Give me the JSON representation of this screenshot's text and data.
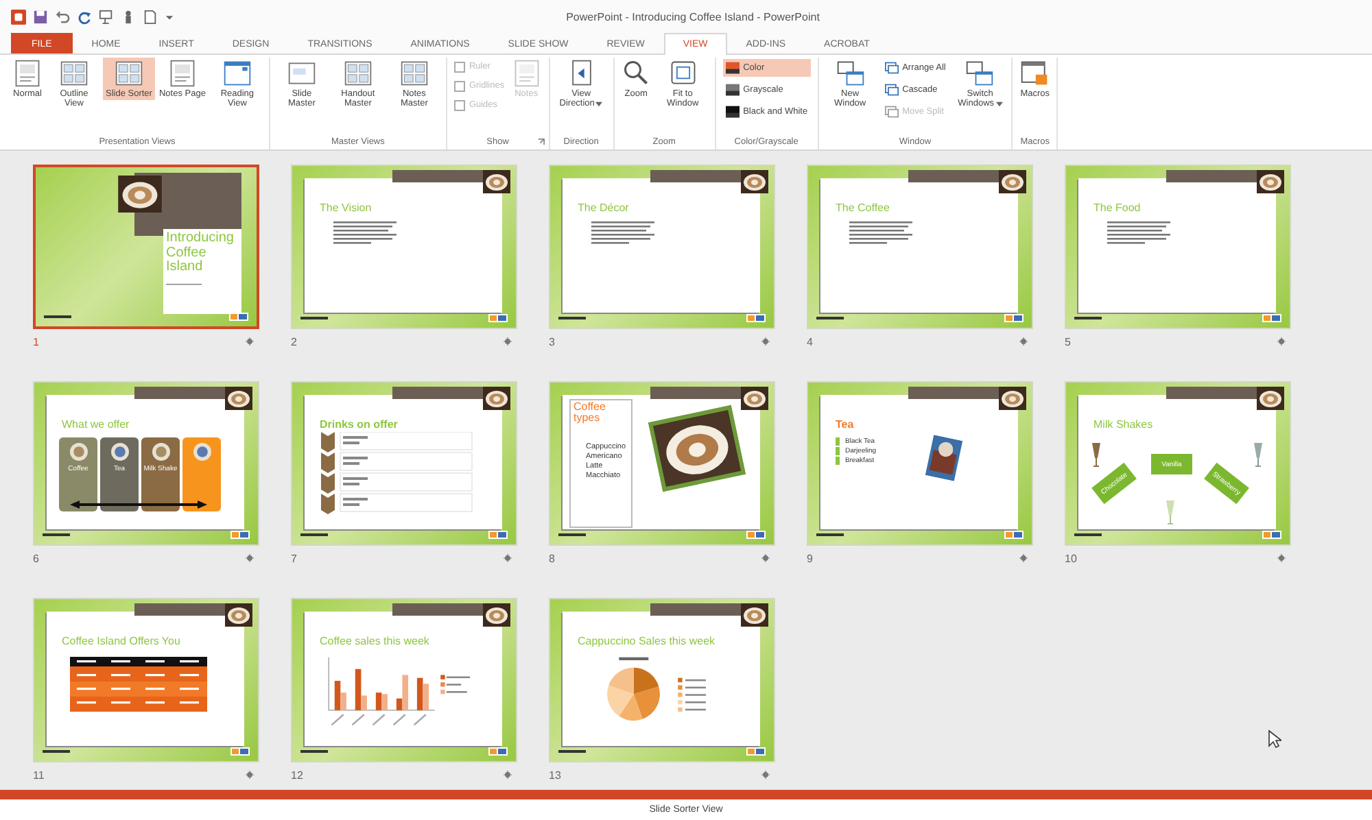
{
  "window": {
    "title": "PowerPoint - Introducing Coffee Island - PowerPoint"
  },
  "ribbon_tabs": [
    {
      "label": "FILE",
      "kind": "file",
      "selected": false
    },
    {
      "label": "HOME",
      "kind": "tab",
      "selected": false
    },
    {
      "label": "INSERT",
      "kind": "tab",
      "selected": false
    },
    {
      "label": "DESIGN",
      "kind": "tab",
      "selected": false
    },
    {
      "label": "TRANSITIONS",
      "kind": "tab",
      "selected": false
    },
    {
      "label": "ANIMATIONS",
      "kind": "tab",
      "selected": false
    },
    {
      "label": "SLIDE SHOW",
      "kind": "tab",
      "selected": false
    },
    {
      "label": "REVIEW",
      "kind": "tab",
      "selected": false
    },
    {
      "label": "VIEW",
      "kind": "tab",
      "selected": true
    },
    {
      "label": "ADD-INS",
      "kind": "tab",
      "selected": false
    },
    {
      "label": "ACROBAT",
      "kind": "tab",
      "selected": false
    }
  ],
  "ribbon_groups": [
    {
      "name": "Presentation Views",
      "items": [
        {
          "kind": "large",
          "label": "Normal",
          "selected": false
        },
        {
          "kind": "large",
          "label": "Outline View",
          "selected": false
        },
        {
          "kind": "large",
          "label": "Slide Sorter",
          "selected": true
        },
        {
          "kind": "large",
          "label": "Notes Page",
          "selected": false
        },
        {
          "kind": "large",
          "label": "Reading View",
          "selected": false
        }
      ]
    },
    {
      "name": "Master Views",
      "items": [
        {
          "kind": "large",
          "label": "Slide Master"
        },
        {
          "kind": "large",
          "label": "Handout Master"
        },
        {
          "kind": "large",
          "label": "Notes Master"
        }
      ]
    },
    {
      "name": "Show",
      "launcher": true,
      "items": [
        {
          "kind": "stack",
          "items": [
            {
              "kind": "check",
              "label": "Ruler",
              "checked": false,
              "disabled": true
            },
            {
              "kind": "check",
              "label": "Gridlines",
              "checked": false,
              "disabled": true
            },
            {
              "kind": "check",
              "label": "Guides",
              "checked": false,
              "disabled": true
            }
          ]
        },
        {
          "kind": "large",
          "label": "Notes",
          "disabled": true
        }
      ]
    },
    {
      "name": "Direction",
      "items": [
        {
          "kind": "large",
          "label": "View Direction",
          "dropdown": true
        }
      ]
    },
    {
      "name": "Zoom",
      "items": [
        {
          "kind": "large",
          "label": "Zoom"
        },
        {
          "kind": "large",
          "label": "Fit to Window"
        }
      ]
    },
    {
      "name": "Color/Grayscale",
      "items": [
        {
          "kind": "stack",
          "items": [
            {
              "kind": "small",
              "label": "Color",
              "selected": true
            },
            {
              "kind": "small",
              "label": "Grayscale",
              "selected": false
            },
            {
              "kind": "small",
              "label": "Black and White",
              "selected": false
            }
          ]
        }
      ]
    },
    {
      "name": "Window",
      "items": [
        {
          "kind": "large",
          "label": "New Window"
        },
        {
          "kind": "stack",
          "items": [
            {
              "kind": "small",
              "label": "Arrange All",
              "disabled": false
            },
            {
              "kind": "small",
              "label": "Cascade",
              "disabled": false
            },
            {
              "kind": "small",
              "label": "Move Split",
              "disabled": true
            }
          ]
        },
        {
          "kind": "large",
          "label": "Switch Windows",
          "dropdown": true
        }
      ]
    },
    {
      "name": "Macros",
      "items": [
        {
          "kind": "large",
          "label": "Macros"
        }
      ]
    }
  ],
  "slides": [
    {
      "number": "1",
      "kind": "title",
      "title": "Introducing Coffee Island",
      "selected": true
    },
    {
      "number": "2",
      "kind": "text",
      "title": "The Vision",
      "selected": false
    },
    {
      "number": "3",
      "kind": "text",
      "title": "The Décor",
      "selected": false
    },
    {
      "number": "4",
      "kind": "text",
      "title": "The Coffee",
      "selected": false
    },
    {
      "number": "5",
      "kind": "text",
      "title": "The Food",
      "selected": false
    },
    {
      "number": "6",
      "kind": "offers",
      "title": "What we offer",
      "selected": false,
      "items": [
        {
          "label": "Coffee",
          "color": "#8a8a68"
        },
        {
          "label": "Tea",
          "color": "#6e6a5e"
        },
        {
          "label": "Milk Shake",
          "color": "#8b6b43"
        },
        {
          "color": "#f7941d"
        }
      ]
    },
    {
      "number": "7",
      "kind": "drinks",
      "title": "Drinks on offer",
      "selected": false
    },
    {
      "number": "8",
      "kind": "types",
      "title": "Coffee types",
      "selected": false,
      "items": [
        "Cappuccino",
        "Americano",
        "Latte",
        "Macchiato"
      ]
    },
    {
      "number": "9",
      "kind": "tea",
      "title": "Tea",
      "selected": false,
      "items": [
        "Black Tea",
        "Darjeeling",
        "Breakfast"
      ]
    },
    {
      "number": "10",
      "kind": "shakes",
      "title": "Milk Shakes",
      "selected": false,
      "items": [
        "Chocolate",
        "Vanilla",
        "Strawberry"
      ]
    },
    {
      "number": "11",
      "kind": "table",
      "title": "Coffee Island Offers You",
      "selected": false
    },
    {
      "number": "12",
      "kind": "bar",
      "title": "Coffee sales this week",
      "selected": false
    },
    {
      "number": "13",
      "kind": "pie",
      "title": "Cappuccino Sales this week",
      "selected": false
    }
  ],
  "caption": "Slide Sorter View"
}
